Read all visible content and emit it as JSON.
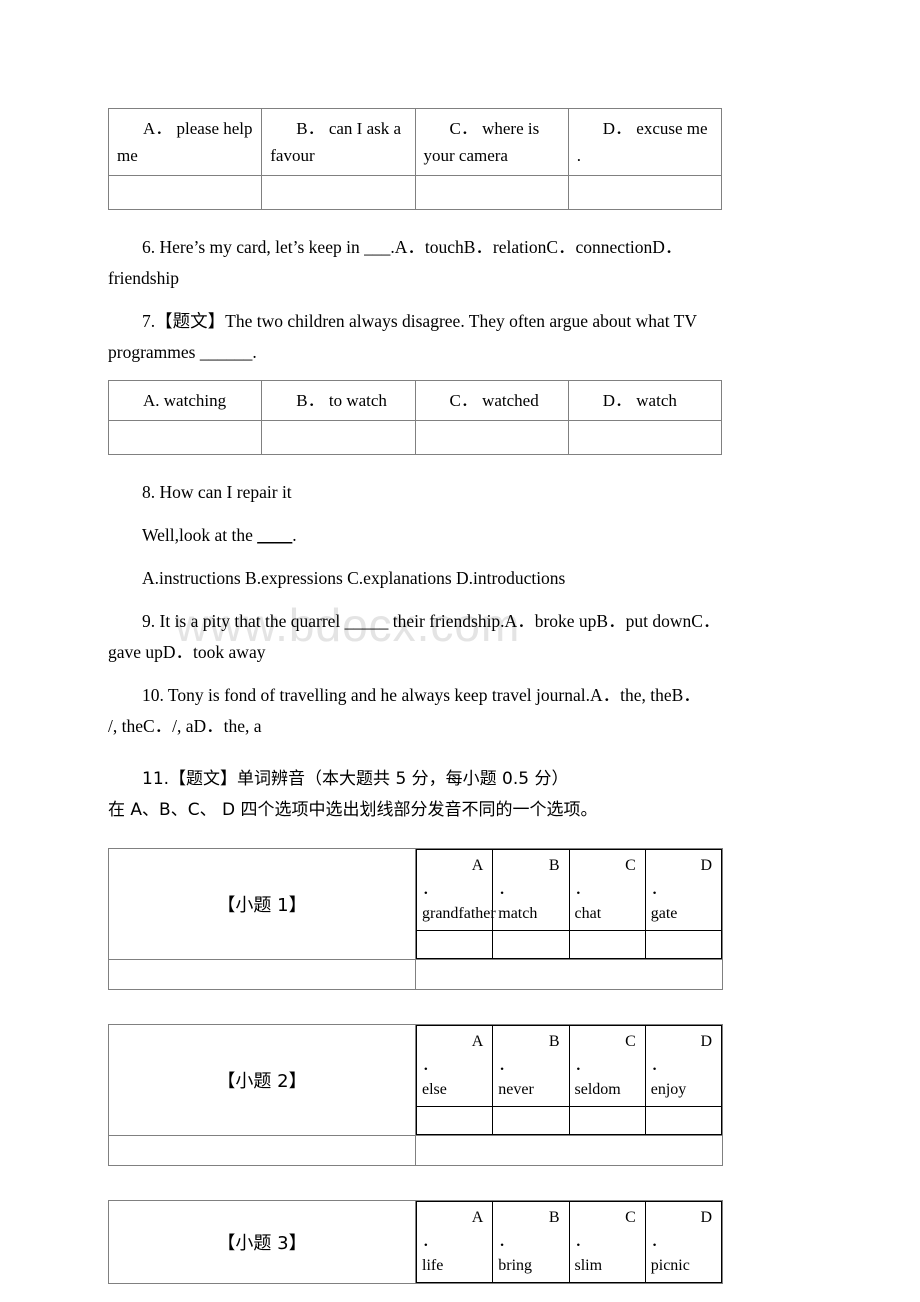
{
  "watermark": {
    "text": "www.bdocx.com"
  },
  "question5": {
    "options_row": [
      {
        "letter": "A．",
        "text": "please help me"
      },
      {
        "letter": "B．",
        "text": "can I ask a favour"
      },
      {
        "letter": "C．",
        "text": "where is your camera"
      },
      {
        "letter": "D．",
        "text": "excuse me ."
      }
    ]
  },
  "question6": {
    "text": "6. Here’s my card, let’s keep in ___.A．touchB．relationC．connectionD．friendship"
  },
  "question7": {
    "stem_line1": "7.【题文】The two children always disagree. They often argue about what TV",
    "stem_line2": "programmes ______.",
    "options_row": [
      {
        "letter": "A.",
        "text": "watching"
      },
      {
        "letter": "B．",
        "text": "to watch"
      },
      {
        "letter": "C．",
        "text": "watched"
      },
      {
        "letter": "D．",
        "text": "watch"
      }
    ]
  },
  "question8": {
    "line1": "8. How can I repair it",
    "line2_pre": "Well,look at the ",
    "line2_blank": "____",
    "line2_post": ".",
    "options_line": "A.instructions    B.expressions C.explanations   D.introductions"
  },
  "question9": {
    "line1": "9. It is a pity that the quarrel _____ their friendship.A．broke upB．put downC．",
    "line2": "gave upD．took away"
  },
  "question10": {
    "line1": "10. Tony is fond of  travelling and he always keep    travel journal.A．the, theB．",
    "line2": "/, theC．/, aD．the, a"
  },
  "question11": {
    "heading": "11.【题文】单词辨音（本大题共 5 分，每小题 0.5 分）",
    "instruction": "在 A、B、C、 D 四个选项中选出划线部分发音不同的一个选项。",
    "subquestions": [
      {
        "label": "【小题 1】",
        "options": [
          {
            "letter": "A",
            "dot": "．",
            "word": "grandfather"
          },
          {
            "letter": "B",
            "dot": "．",
            "word": "match"
          },
          {
            "letter": "C",
            "dot": "．",
            "word": "chat"
          },
          {
            "letter": "D",
            "dot": "．",
            "word": "gate"
          }
        ],
        "has_answer_row": true,
        "has_shell_blank": true
      },
      {
        "label": "【小题 2】",
        "options": [
          {
            "letter": "A",
            "dot": "．",
            "word": "else"
          },
          {
            "letter": "B",
            "dot": "．",
            "word": "never"
          },
          {
            "letter": "C",
            "dot": "．",
            "word": "seldom"
          },
          {
            "letter": "D",
            "dot": "．",
            "word": "enjoy"
          }
        ],
        "has_answer_row": true,
        "has_shell_blank": true
      },
      {
        "label": "【小题 3】",
        "options": [
          {
            "letter": "A",
            "dot": "．",
            "word": "life"
          },
          {
            "letter": "B",
            "dot": "．",
            "word": "bring"
          },
          {
            "letter": "C",
            "dot": "．",
            "word": "slim"
          },
          {
            "letter": "D",
            "dot": "．",
            "word": "picnic"
          }
        ],
        "has_answer_row": false,
        "has_shell_blank": false
      }
    ]
  }
}
